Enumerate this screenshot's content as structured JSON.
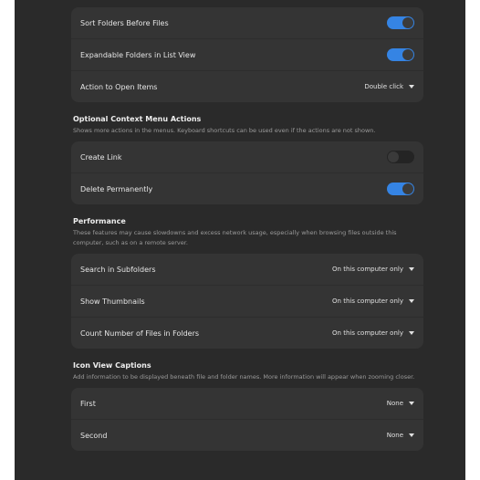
{
  "general": {
    "rows": [
      {
        "label": "Sort Folders Before Files",
        "switch_on": true
      },
      {
        "label": "Expandable Folders in List View",
        "switch_on": true
      },
      {
        "label": "Action to Open Items",
        "value": "Double click"
      }
    ]
  },
  "context_menu": {
    "title": "Optional Context Menu Actions",
    "description": "Shows more actions in the menus. Keyboard shortcuts can be used even if the actions are not shown.",
    "rows": [
      {
        "label": "Create Link",
        "switch_on": false
      },
      {
        "label": "Delete Permanently",
        "switch_on": true
      }
    ]
  },
  "performance": {
    "title": "Performance",
    "description": "These features may cause slowdowns and excess network usage, especially when browsing files outside this computer, such as on a remote server.",
    "rows": [
      {
        "label": "Search in Subfolders",
        "value": "On this computer only"
      },
      {
        "label": "Show Thumbnails",
        "value": "On this computer only"
      },
      {
        "label": "Count Number of Files in Folders",
        "value": "On this computer only"
      }
    ]
  },
  "icon_view": {
    "title": "Icon View Captions",
    "description": "Add information to be displayed beneath file and folder names. More information will appear when zooming closer.",
    "rows": [
      {
        "label": "First",
        "value": "None"
      },
      {
        "label": "Second",
        "value": "None"
      }
    ]
  },
  "colors": {
    "accent": "#3584e4",
    "window_bg": "#2a2a2a",
    "card_bg": "#343434"
  }
}
